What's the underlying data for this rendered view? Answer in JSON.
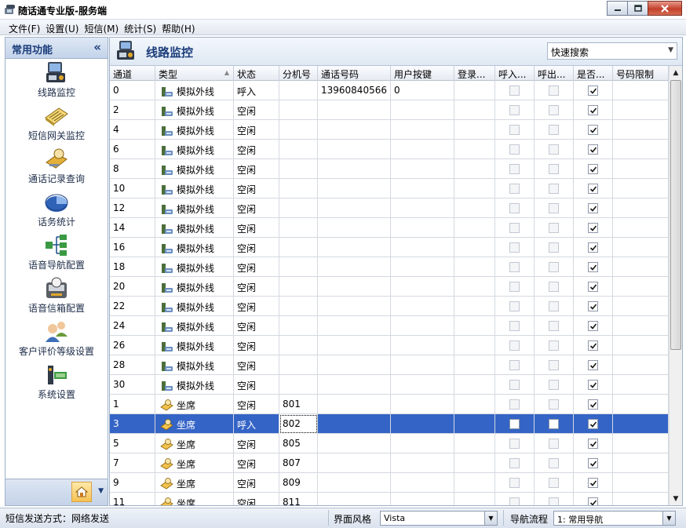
{
  "window": {
    "title": "随话通专业版-服务端"
  },
  "menu": [
    "文件(F)",
    "设置(U)",
    "短信(M)",
    "统计(S)",
    "帮助(H)"
  ],
  "sidebar": {
    "title": "常用功能",
    "items": [
      {
        "label": "线路监控",
        "icon": "phone-line-monitor-icon"
      },
      {
        "label": "短信网关监控",
        "icon": "sms-gateway-icon"
      },
      {
        "label": "通话记录查询",
        "icon": "call-record-icon"
      },
      {
        "label": "话务统计",
        "icon": "pie-chart-icon"
      },
      {
        "label": "语音导航配置",
        "icon": "voice-navigation-icon"
      },
      {
        "label": "语音信箱配置",
        "icon": "voice-mailbox-icon"
      },
      {
        "label": "客户评价等级设置",
        "icon": "customer-rating-icon"
      },
      {
        "label": "系统设置",
        "icon": "system-settings-icon"
      }
    ]
  },
  "main": {
    "title": "线路监控",
    "search": {
      "value": "快速搜索"
    }
  },
  "table": {
    "columns": [
      "通道",
      "类型",
      "状态",
      "分机号",
      "通话号码",
      "用户按键",
      "登录...",
      "呼入...",
      "呼出...",
      "是否...",
      "号码限制"
    ],
    "rows": [
      {
        "channel": "0",
        "type": "模拟外线",
        "kind": "line",
        "status": "呼入",
        "ext": "",
        "number": "13960840566",
        "key": "0",
        "selected": false
      },
      {
        "channel": "2",
        "type": "模拟外线",
        "kind": "line",
        "status": "空闲",
        "ext": "",
        "number": "",
        "key": "",
        "selected": false
      },
      {
        "channel": "4",
        "type": "模拟外线",
        "kind": "line",
        "status": "空闲",
        "ext": "",
        "number": "",
        "key": "",
        "selected": false
      },
      {
        "channel": "6",
        "type": "模拟外线",
        "kind": "line",
        "status": "空闲",
        "ext": "",
        "number": "",
        "key": "",
        "selected": false
      },
      {
        "channel": "8",
        "type": "模拟外线",
        "kind": "line",
        "status": "空闲",
        "ext": "",
        "number": "",
        "key": "",
        "selected": false
      },
      {
        "channel": "10",
        "type": "模拟外线",
        "kind": "line",
        "status": "空闲",
        "ext": "",
        "number": "",
        "key": "",
        "selected": false
      },
      {
        "channel": "12",
        "type": "模拟外线",
        "kind": "line",
        "status": "空闲",
        "ext": "",
        "number": "",
        "key": "",
        "selected": false
      },
      {
        "channel": "14",
        "type": "模拟外线",
        "kind": "line",
        "status": "空闲",
        "ext": "",
        "number": "",
        "key": "",
        "selected": false
      },
      {
        "channel": "16",
        "type": "模拟外线",
        "kind": "line",
        "status": "空闲",
        "ext": "",
        "number": "",
        "key": "",
        "selected": false
      },
      {
        "channel": "18",
        "type": "模拟外线",
        "kind": "line",
        "status": "空闲",
        "ext": "",
        "number": "",
        "key": "",
        "selected": false
      },
      {
        "channel": "20",
        "type": "模拟外线",
        "kind": "line",
        "status": "空闲",
        "ext": "",
        "number": "",
        "key": "",
        "selected": false
      },
      {
        "channel": "22",
        "type": "模拟外线",
        "kind": "line",
        "status": "空闲",
        "ext": "",
        "number": "",
        "key": "",
        "selected": false
      },
      {
        "channel": "24",
        "type": "模拟外线",
        "kind": "line",
        "status": "空闲",
        "ext": "",
        "number": "",
        "key": "",
        "selected": false
      },
      {
        "channel": "26",
        "type": "模拟外线",
        "kind": "line",
        "status": "空闲",
        "ext": "",
        "number": "",
        "key": "",
        "selected": false
      },
      {
        "channel": "28",
        "type": "模拟外线",
        "kind": "line",
        "status": "空闲",
        "ext": "",
        "number": "",
        "key": "",
        "selected": false
      },
      {
        "channel": "30",
        "type": "模拟外线",
        "kind": "line",
        "status": "空闲",
        "ext": "",
        "number": "",
        "key": "",
        "selected": false
      },
      {
        "channel": "1",
        "type": "坐席",
        "kind": "seat",
        "status": "空闲",
        "ext": "801",
        "number": "",
        "key": "",
        "selected": false
      },
      {
        "channel": "3",
        "type": "坐席",
        "kind": "seat",
        "status": "呼入",
        "ext": "802",
        "number": "",
        "key": "",
        "selected": true
      },
      {
        "channel": "5",
        "type": "坐席",
        "kind": "seat",
        "status": "空闲",
        "ext": "805",
        "number": "",
        "key": "",
        "selected": false
      },
      {
        "channel": "7",
        "type": "坐席",
        "kind": "seat",
        "status": "空闲",
        "ext": "807",
        "number": "",
        "key": "",
        "selected": false
      },
      {
        "channel": "9",
        "type": "坐席",
        "kind": "seat",
        "status": "空闲",
        "ext": "809",
        "number": "",
        "key": "",
        "selected": false
      },
      {
        "channel": "11",
        "type": "坐席",
        "kind": "seat",
        "status": "空闲",
        "ext": "811",
        "number": "",
        "key": "",
        "selected": false
      }
    ]
  },
  "statusbar": {
    "sms_mode": "短信发送方式：网络发送",
    "skin_label": "界面风格",
    "skin_value": "Vista",
    "flow_label": "导航流程",
    "flow_value": "1: 常用导航"
  },
  "colors": {
    "selection": "#3464c6",
    "sidebar_title": "#1b3d7a"
  }
}
